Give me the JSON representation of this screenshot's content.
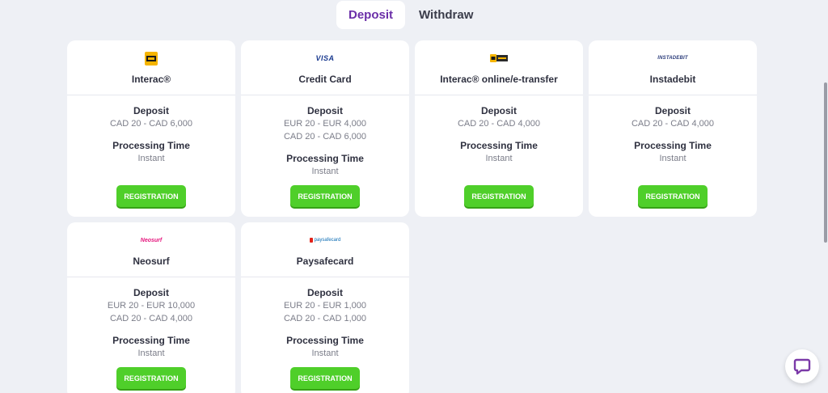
{
  "tabs": [
    {
      "label": "Deposit",
      "active": true
    },
    {
      "label": "Withdraw",
      "active": false
    }
  ],
  "labels": {
    "deposit": "Deposit",
    "processing": "Processing Time",
    "button": "REGISTRATION"
  },
  "methods": [
    {
      "name": "Interac®",
      "logo": "interac-logo",
      "limits": [
        "CAD 20 - CAD 6,000"
      ],
      "time": "Instant"
    },
    {
      "name": "Credit Card",
      "logo": "visa-logo",
      "logo_text": "VISA",
      "limits": [
        "EUR 20 - EUR 4,000",
        "CAD 20 - CAD 6,000"
      ],
      "time": "Instant"
    },
    {
      "name": "Interac® online/e-transfer",
      "logo": "interac-online-logo",
      "limits": [
        "CAD 20 - CAD 4,000"
      ],
      "time": "Instant"
    },
    {
      "name": "Instadebit",
      "logo": "instadebit-logo",
      "logo_text": "INSTADEBIT",
      "limits": [
        "CAD 20 - CAD 4,000"
      ],
      "time": "Instant"
    },
    {
      "name": "Neosurf",
      "logo": "neosurf-logo",
      "logo_text": "Neosurf",
      "limits": [
        "EUR 20 - EUR 10,000",
        "CAD 20 - CAD 4,000"
      ],
      "time": "Instant"
    },
    {
      "name": "Paysafecard",
      "logo": "paysafecard-logo",
      "logo_text": "paysafecard",
      "limits": [
        "EUR 20 - EUR 1,000",
        "CAD 20 - CAD 1,000"
      ],
      "time": "Instant"
    }
  ],
  "colors": {
    "accent": "#6b2fa8",
    "button": "#4fcf2a",
    "background": "#eef0f5"
  }
}
